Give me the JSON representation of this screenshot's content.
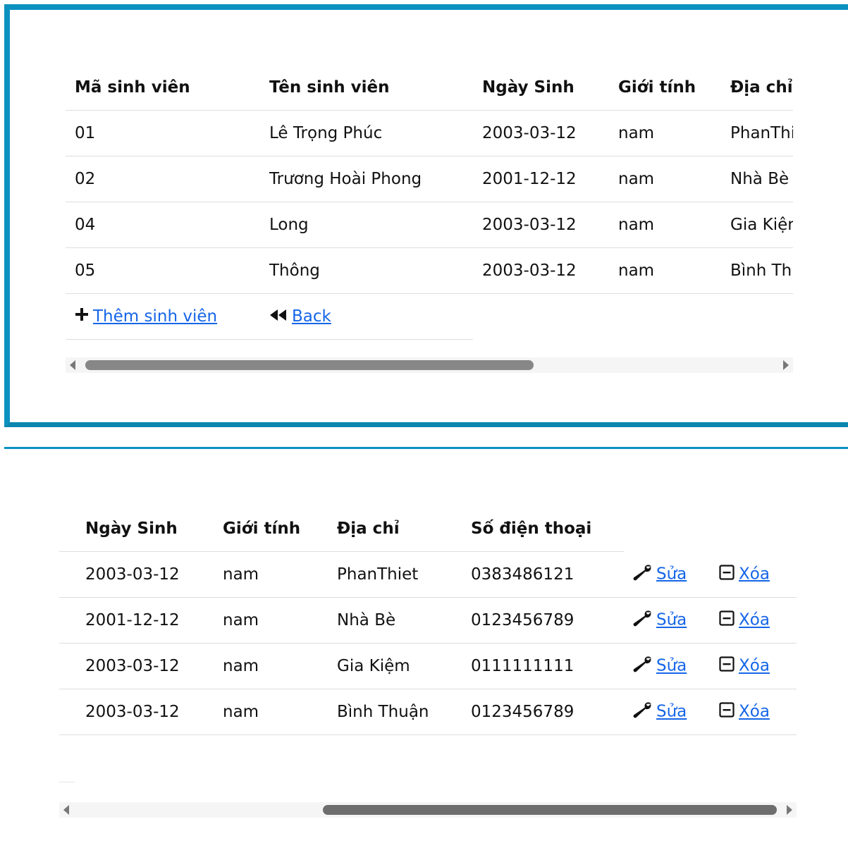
{
  "top_table": {
    "headers": [
      "Mã sinh viên",
      "Tên sinh viên",
      "Ngày Sinh",
      "Giới tính",
      "Địa chỉ"
    ],
    "rows": [
      [
        "01",
        "Lê Trọng Phúc",
        "2003-03-12",
        "nam",
        "PhanThiet"
      ],
      [
        "02",
        "Trương Hoài Phong",
        "2001-12-12",
        "nam",
        "Nhà Bè"
      ],
      [
        "04",
        "Long",
        "2003-03-12",
        "nam",
        "Gia Kiệm"
      ],
      [
        "05",
        "Thông",
        "2003-03-12",
        "nam",
        "Bình Thuận"
      ]
    ],
    "add_label": "Thêm sinh viên",
    "back_label": "Back"
  },
  "bottom_table": {
    "headers": [
      "Ngày Sinh",
      "Giới tính",
      "Địa chỉ",
      "Số điện thoại"
    ],
    "rows": [
      [
        "2003-03-12",
        "nam",
        "PhanThiet",
        "0383486121"
      ],
      [
        "2001-12-12",
        "nam",
        "Nhà Bè",
        "0123456789"
      ],
      [
        "2003-03-12",
        "nam",
        "Gia Kiệm",
        "0111111111"
      ],
      [
        "2003-03-12",
        "nam",
        "Bình Thuận",
        "0123456789"
      ]
    ],
    "edit_label": "Sửa",
    "delete_label": "Xóa"
  },
  "icons": {
    "add": "plus-icon",
    "back": "rewind-icon",
    "edit": "wrench-icon",
    "delete": "minus-square-icon"
  },
  "colors": {
    "accent": "#0b91bf",
    "link": "#1565e8"
  }
}
